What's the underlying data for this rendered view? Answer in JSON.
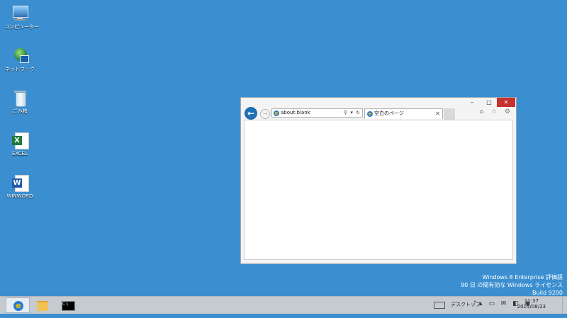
{
  "desktop": {
    "icons": [
      {
        "label": "コンピューター",
        "icon": "computer-icon"
      },
      {
        "label": "ネットワーク",
        "icon": "network-icon"
      },
      {
        "label": "ごみ箱",
        "icon": "recycle-bin-icon"
      },
      {
        "label": "EXCEL",
        "icon": "excel-icon"
      },
      {
        "label": "WINWORD",
        "icon": "word-icon"
      }
    ]
  },
  "browser": {
    "address": "about:blank",
    "address_tools": "⚲ ▾ ↻",
    "tab_title": "空白のページ",
    "tab_close": "✕",
    "window_buttons": {
      "minimize": "–",
      "maximize": "□",
      "close": "✕"
    },
    "right_icons": "⌂ ☆ ⚙"
  },
  "watermark": {
    "line1": "Windows 8 Enterprise 評価版",
    "line2": "90 日 の間有効な Windows ライセンス",
    "line3": "Build 9200"
  },
  "taskbar": {
    "tray_label": "デスクトップ",
    "time": "11:37",
    "date": "2014/08/23"
  },
  "colors": {
    "desktop_bg": "#3b8fd0",
    "close_button": "#c7302b",
    "taskbar": "#c6cbd0"
  }
}
